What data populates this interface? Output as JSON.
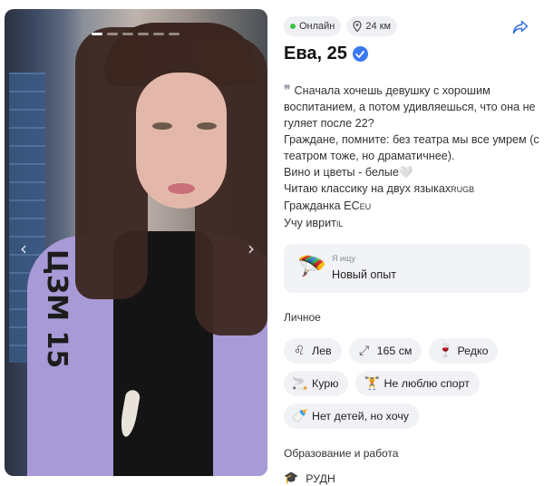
{
  "photo": {
    "slides_total": 6,
    "active_slide": 1
  },
  "status": {
    "online_label": "Онлайн",
    "distance_label": "24 км"
  },
  "profile": {
    "name_age": "Ева, 25"
  },
  "bio": {
    "lines": [
      "Сначала хочешь девушку с хорошим воспитанием, а потом удивляешься, что она не гуляет после 22?",
      "Граждане, помните: без театра мы все умрем (с театром тоже, но драматичнее).",
      "Вино и цветы - белые🤍",
      "Читаю классику на двух языках",
      "Гражданка EC",
      "Учу иврит"
    ],
    "flag_ru_gb": "RUGB",
    "flag_eu": "EU",
    "flag_il": "IL"
  },
  "looking_for": {
    "label": "Я ищу",
    "value": "Новый опыт",
    "icon": "parachute-emoji"
  },
  "personal": {
    "title": "Личное",
    "chips": [
      {
        "icon": "leo-icon",
        "glyph": "♌",
        "label": "Лев"
      },
      {
        "icon": "height-icon",
        "glyph": "⤢",
        "label": "165 см"
      },
      {
        "icon": "glass-icon",
        "glyph": "🍷",
        "label": "Редко"
      },
      {
        "icon": "cigarette-icon",
        "glyph": "🚬",
        "label": "Курю"
      },
      {
        "icon": "dumbbell-icon",
        "glyph": "🏋",
        "label": "Не люблю спорт"
      },
      {
        "icon": "baby-bottle-icon",
        "glyph": "🍼",
        "label": "Нет детей, но хочу"
      }
    ]
  },
  "education": {
    "title": "Образование и работа",
    "university": "РУДН"
  },
  "colors": {
    "online": "#3cc24a",
    "verified": "#3a78f0",
    "chip_bg": "#f1f2f5",
    "jacket": "#a89ad6"
  }
}
